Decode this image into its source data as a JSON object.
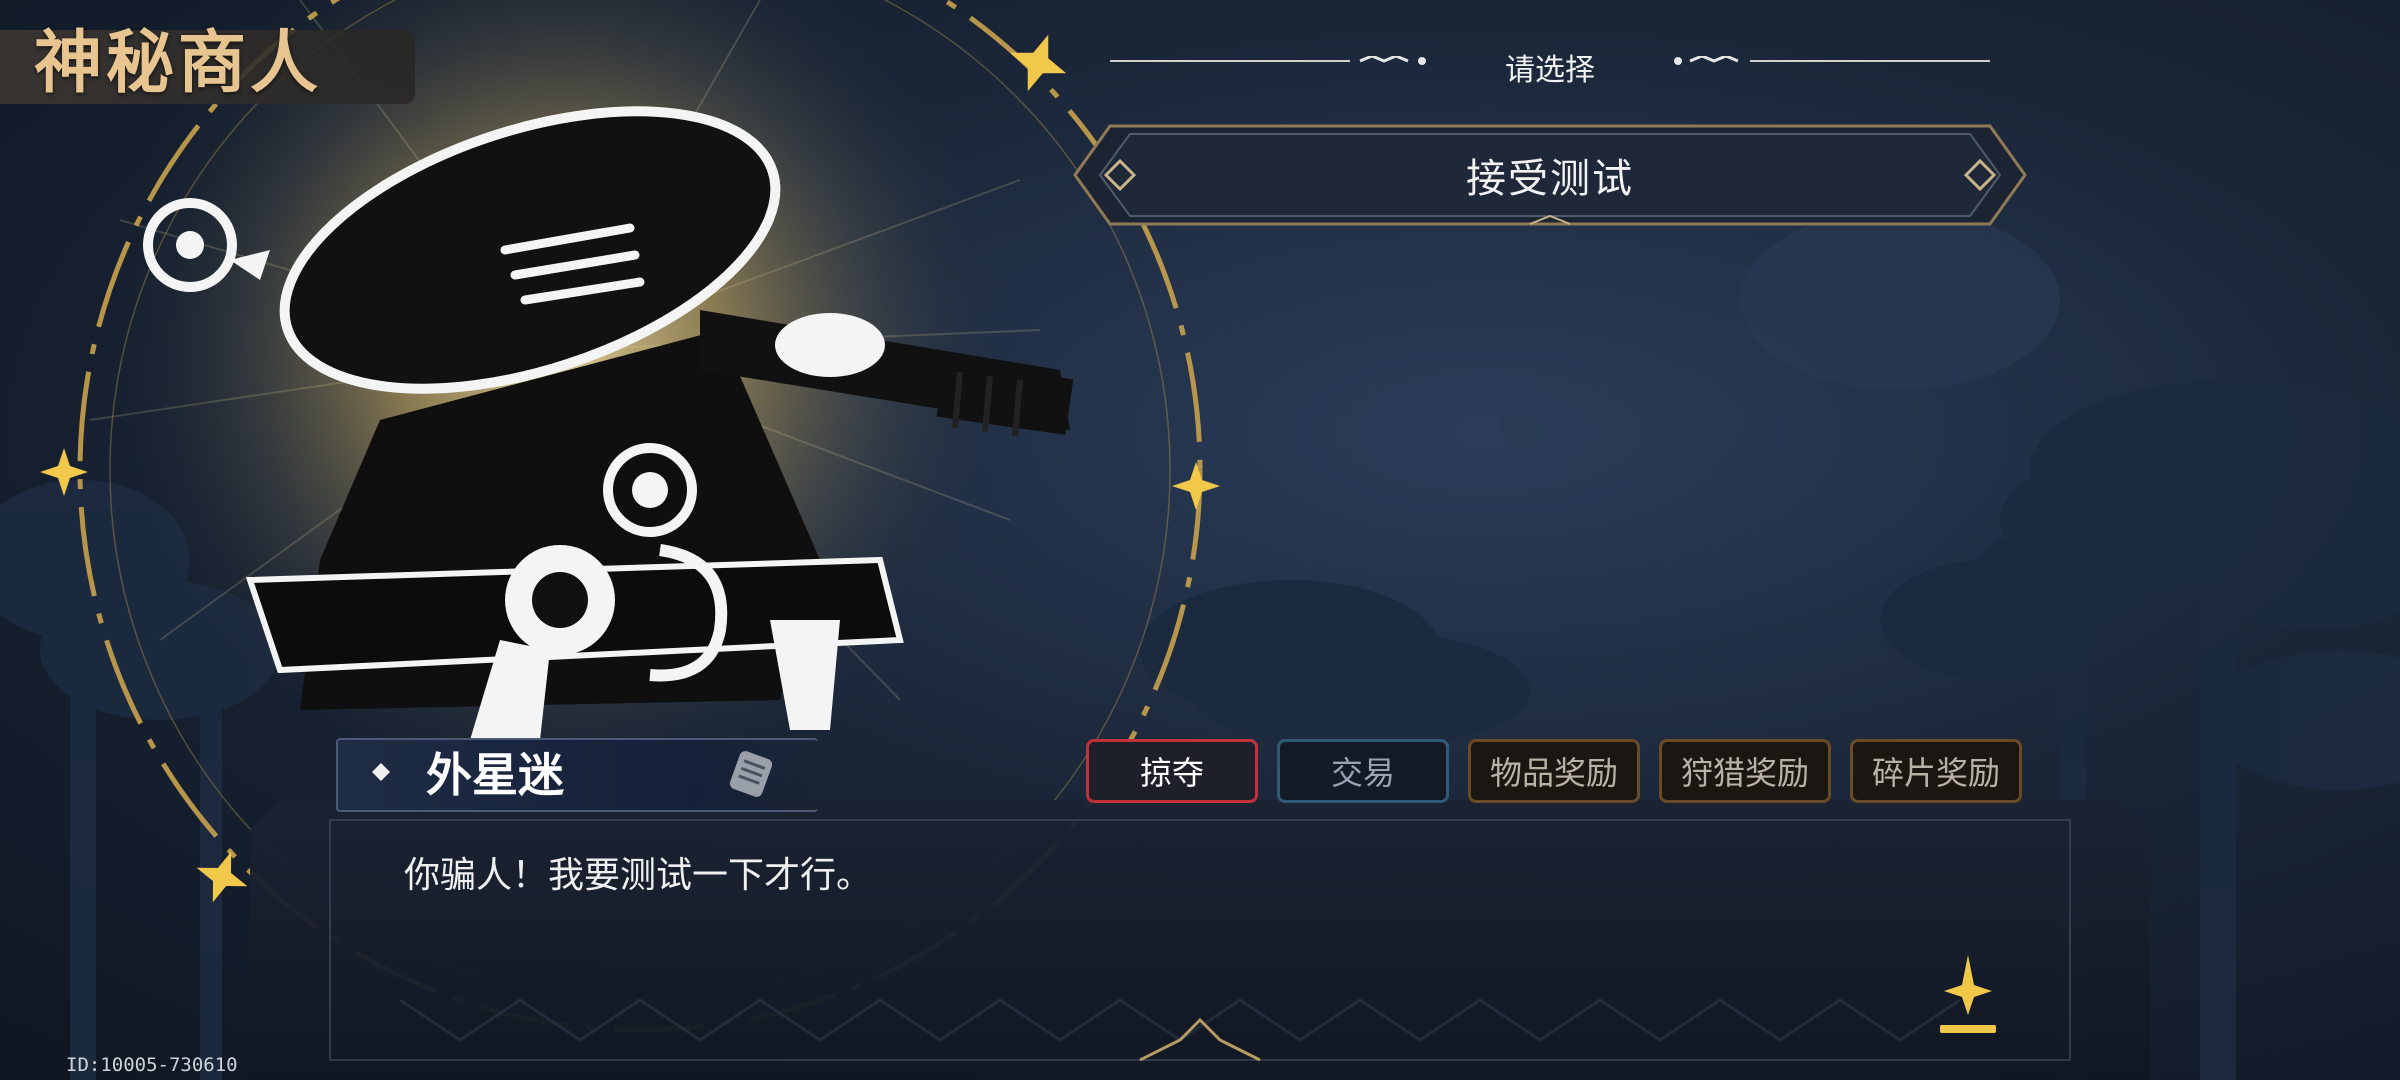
{
  "header": {
    "title": "神秘商人",
    "choose_label": "请选择"
  },
  "choices": [
    {
      "label": "接受测试"
    }
  ],
  "dialog": {
    "speaker": "外星迷",
    "text": "你骗人！我要测试一下才行。"
  },
  "tabs": [
    {
      "label": "掠夺",
      "state": "active",
      "border": "#c2313a"
    },
    {
      "label": "交易",
      "state": "inactive",
      "border": "#2f5a78"
    },
    {
      "label": "物品奖励",
      "state": "inactive",
      "border": "#6b4a26"
    },
    {
      "label": "狩猎奖励",
      "state": "inactive",
      "border": "#6b4a26"
    },
    {
      "label": "碎片奖励",
      "state": "inactive",
      "border": "#6b4a26"
    }
  ],
  "footer": {
    "id_label": "ID:10005-730610"
  },
  "colors": {
    "accent_gold": "#e8c590",
    "star_gold": "#f2c84b",
    "panel_dark": "#151c2b"
  },
  "icons": {
    "next": "down-arrow-icon",
    "scroll": "scroll-icon",
    "star": "sparkle-star-icon"
  }
}
